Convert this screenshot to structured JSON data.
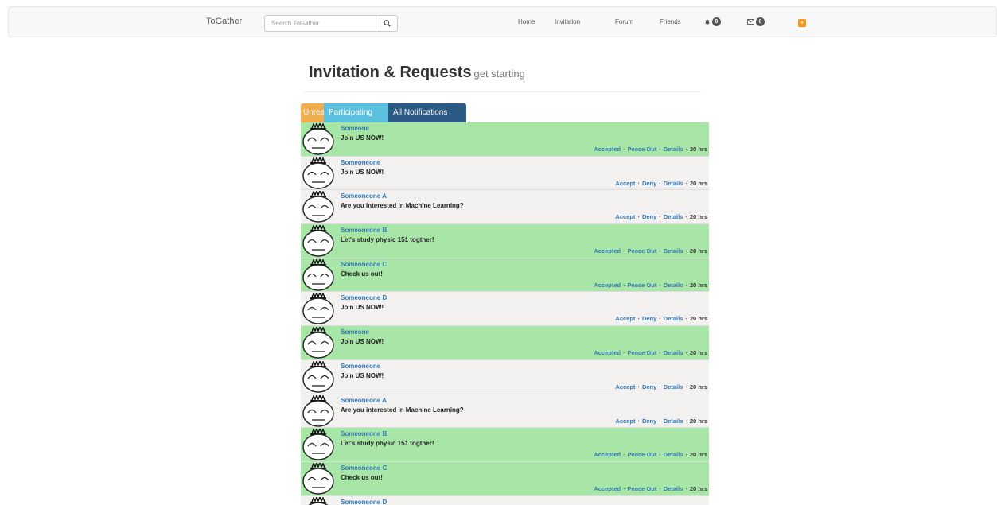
{
  "navbar": {
    "brand": "ToGather",
    "search_placeholder": "Search ToGather",
    "links": [
      "Home",
      "Invitation",
      "Forum",
      "Friends"
    ],
    "notifications_count": "0",
    "messages_count": "0"
  },
  "header": {
    "title": "Invitation & Requests",
    "subtitle": "get starting"
  },
  "tabs": [
    "Unread",
    "Participating",
    "All Notifications"
  ],
  "colors": {
    "accepted_row": "#a8e6a8",
    "pending_row": "#f3f0f0",
    "tab_unread": "#f0ad4e",
    "tab_participating": "#5bc0de",
    "tab_all": "#2b5a85"
  },
  "separator": "·",
  "items": [
    {
      "sender": "Someone",
      "message": "Join US NOW!",
      "status": "accepted",
      "actions": [
        "Accepted",
        "Peace Out",
        "Details"
      ],
      "time": "20 hrs"
    },
    {
      "sender": "Someoneone",
      "message": "Join US NOW!",
      "status": "pending",
      "actions": [
        "Accept",
        "Deny",
        "Details"
      ],
      "time": "20 hrs"
    },
    {
      "sender": "Someoneone A",
      "message": "Are you interested in Machine Learning?",
      "status": "pending",
      "actions": [
        "Accept",
        "Deny",
        "Details"
      ],
      "time": "20 hrs"
    },
    {
      "sender": "Someoneone B",
      "message": "Let's study physic 151 togther!",
      "status": "accepted",
      "actions": [
        "Accepted",
        "Peace Out",
        "Details"
      ],
      "time": "20 hrs"
    },
    {
      "sender": "Someoneone C",
      "message": "Check us out!",
      "status": "accepted",
      "actions": [
        "Accepted",
        "Peace Out",
        "Details"
      ],
      "time": "20 hrs"
    },
    {
      "sender": "Someoneone D",
      "message": "Join US NOW!",
      "status": "pending",
      "actions": [
        "Accept",
        "Deny",
        "Details"
      ],
      "time": "20 hrs"
    },
    {
      "sender": "Someone",
      "message": "Join US NOW!",
      "status": "accepted",
      "actions": [
        "Accepted",
        "Peace Out",
        "Details"
      ],
      "time": "20 hrs"
    },
    {
      "sender": "Someoneone",
      "message": "Join US NOW!",
      "status": "pending",
      "actions": [
        "Accept",
        "Deny",
        "Details"
      ],
      "time": "20 hrs"
    },
    {
      "sender": "Someoneone A",
      "message": "Are you interested in Machine Learning?",
      "status": "pending",
      "actions": [
        "Accept",
        "Deny",
        "Details"
      ],
      "time": "20 hrs"
    },
    {
      "sender": "Someoneone B",
      "message": "Let's study physic 151 togther!",
      "status": "accepted",
      "actions": [
        "Accepted",
        "Peace Out",
        "Details"
      ],
      "time": "20 hrs"
    },
    {
      "sender": "Someoneone C",
      "message": "Check us out!",
      "status": "accepted",
      "actions": [
        "Accepted",
        "Peace Out",
        "Details"
      ],
      "time": "20 hrs"
    },
    {
      "sender": "Someoneone D",
      "message": "",
      "status": "pending",
      "actions": [],
      "time": ""
    }
  ]
}
